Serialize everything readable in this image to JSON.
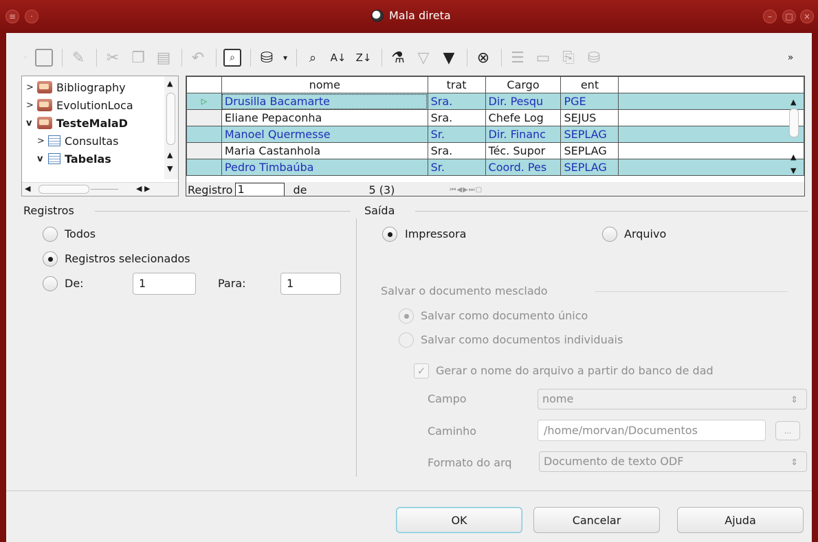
{
  "window": {
    "title": "Mala direta"
  },
  "toolbar": {
    "icons": [
      "save-icon",
      "edit-icon",
      "cut-icon",
      "copy-icon",
      "paste-icon",
      "undo-icon",
      "find-icon",
      "data-source-icon",
      "dropdown-icon",
      "filter-record-icon",
      "sort-ascending-icon",
      "sort-descending-icon",
      "autofilter-icon",
      "standard-filter-icon",
      "apply-filter-icon",
      "remove-filter-icon",
      "text-icon",
      "fields-icon",
      "data-to-text-icon",
      "database-icon",
      "more-icon"
    ]
  },
  "tree": {
    "items": [
      {
        "label": "Bibliography",
        "arrow": ">"
      },
      {
        "label": "EvolutionLoca",
        "arrow": ">"
      },
      {
        "label": "TesteMalaD",
        "arrow": "v"
      },
      {
        "label": "Consultas",
        "arrow": ">"
      },
      {
        "label": "Tabelas",
        "arrow": "v"
      }
    ]
  },
  "grid": {
    "columns": [
      "nome",
      "trat",
      "Cargo",
      "ent"
    ],
    "rows": [
      {
        "nome": "Drusilla Bacamarte",
        "trat": "Sra.",
        "cargo": "Dir. Pesqu",
        "ent": "PGE",
        "selected": true
      },
      {
        "nome": "Eliane Pepaconha",
        "trat": "Sra.",
        "cargo": "Chefe Log",
        "ent": "SEJUS",
        "selected": false
      },
      {
        "nome": "Manoel Quermesse",
        "trat": "Sr.",
        "cargo": "Dir. Financ",
        "ent": "SEPLAG",
        "selected": true
      },
      {
        "nome": "Maria Castanhola",
        "trat": "Sra.",
        "cargo": "Téc. Supor",
        "ent": "SEPLAG",
        "selected": false
      },
      {
        "nome": "Pedro Timbaúba",
        "trat": "Sr.",
        "cargo": "Coord. Pes",
        "ent": "SEPLAG",
        "selected": true
      }
    ],
    "nav": {
      "registro_label": "Registro",
      "registro_value": "1",
      "de_label": "de",
      "count": "5 (3)"
    }
  },
  "registros": {
    "title": "Registros",
    "todos": "Todos",
    "selecionados": "Registros selecionados",
    "de": "De:",
    "de_value": "1",
    "para": "Para:",
    "para_value": "1"
  },
  "saida": {
    "title": "Saída",
    "impressora": "Impressora",
    "arquivo": "Arquivo",
    "salvar_title": "Salvar o documento mesclado",
    "unico": "Salvar como documento único",
    "individuais": "Salvar como documentos individuais",
    "gerar": "Gerar o nome do arquivo a partir do banco de dad",
    "campo_label": "Campo",
    "campo_value": "nome",
    "caminho_label": "Caminho",
    "caminho_value": "/home/morvan/Documentos",
    "browse": "...",
    "formato_label": "Formato do arq",
    "formato_value": "Documento de texto ODF"
  },
  "buttons": {
    "ok": "OK",
    "cancelar": "Cancelar",
    "ajuda": "Ajuda"
  }
}
